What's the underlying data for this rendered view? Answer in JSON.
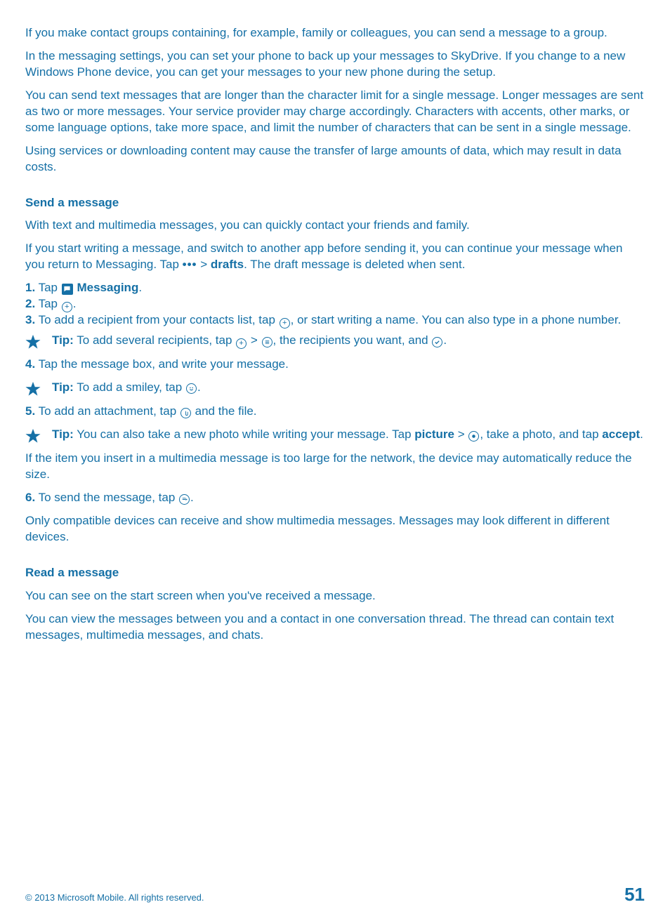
{
  "intro": {
    "p1": "If you make contact groups containing, for example, family or colleagues, you can send a message to a group.",
    "p2": "In the messaging settings, you can set your phone to back up your messages to SkyDrive. If you change to a new Windows Phone device, you can get your messages to your new phone during the setup.",
    "p3": "You can send text messages that are longer than the character limit for a single message. Longer messages are sent as two or more messages. Your service provider may charge accordingly. Characters with accents, other marks, or some language options, take more space, and limit the number of characters that can be sent in a single message.",
    "p4": "Using services or downloading content may cause the transfer of large amounts of data, which may result in data costs."
  },
  "send": {
    "heading": "Send a message",
    "p1": "With text and multimedia messages, you can quickly contact your friends and family.",
    "p2a": "If you start writing a message, and switch to another app before sending it, you can continue your message when you return to Messaging. Tap ",
    "p2b": " > ",
    "p2_drafts": "drafts",
    "p2c": ". The draft message is deleted when sent.",
    "step1_pre": " Tap ",
    "step1_label": " Messaging",
    "step1_post": ".",
    "step2_pre": " Tap ",
    "step2_post": ".",
    "step3_pre": " To add a recipient from your contacts list, tap ",
    "step3_post": ", or start writing a name. You can also type in a phone number.",
    "tip1_label": "Tip:",
    "tip1_a": " To add several recipients, tap ",
    "tip1_b": " > ",
    "tip1_c": ", the recipients you want, and ",
    "tip1_d": ".",
    "step4": " Tap the message box, and write your message.",
    "tip2_label": "Tip:",
    "tip2_a": " To add a smiley, tap ",
    "tip2_b": ".",
    "step5_pre": " To add an attachment, tap ",
    "step5_post": " and the file.",
    "tip3_label": "Tip:",
    "tip3_a": " You can also take a new photo while writing your message. Tap ",
    "tip3_pic": "picture",
    "tip3_b": " > ",
    "tip3_c": ", take a photo, and tap ",
    "tip3_accept": "accept",
    "tip3_d": ".",
    "p3": "If the item you insert in a multimedia message is too large for the network, the device may automatically reduce the size.",
    "step6_pre": " To send the message, tap ",
    "step6_post": ".",
    "p4": "Only compatible devices can receive and show multimedia messages. Messages may look different in different devices."
  },
  "read": {
    "heading": "Read a message",
    "p1": "You can see on the start screen when you've received a message.",
    "p2": "You can view the messages between you and a contact in one conversation thread. The thread can contain text messages, multimedia messages, and chats."
  },
  "footer": {
    "copyright": "© 2013 Microsoft Mobile. All rights reserved.",
    "page": "51"
  },
  "nums": {
    "n1": "1.",
    "n2": "2.",
    "n3": "3.",
    "n4": "4.",
    "n5": "5.",
    "n6": "6."
  },
  "dots": "•••"
}
